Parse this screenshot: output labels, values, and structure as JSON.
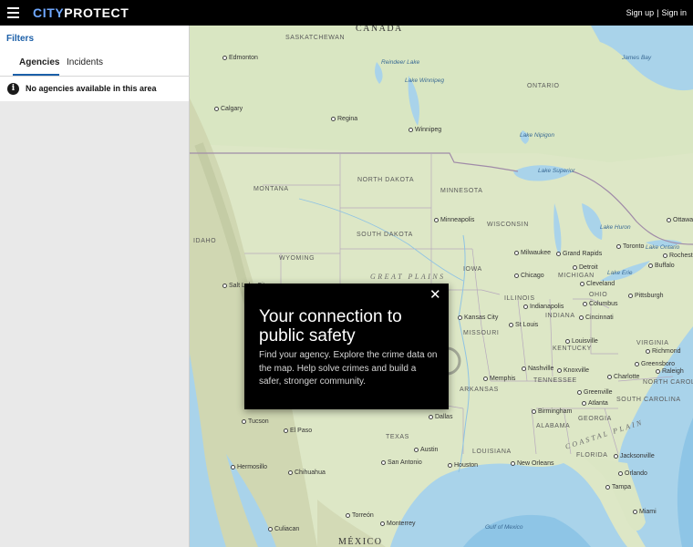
{
  "header": {
    "logo_part1": "CITY",
    "logo_part2": "PROTECT",
    "signup_label": "Sign up",
    "separator": "|",
    "signin_label": "Sign in"
  },
  "sidebar": {
    "filters_label": "Filters",
    "tabs": [
      {
        "label": "Agencies",
        "active": true
      },
      {
        "label": "Incidents",
        "active": false
      }
    ],
    "notice_icon": "info-icon",
    "notice_text": "No agencies available in this area"
  },
  "modal": {
    "title": "Your connection to public safety",
    "body": "Find your agency. Explore the crime data on the map. Help solve crimes and build a safer, stronger community.",
    "close_icon": "close-icon"
  },
  "map": {
    "countries": [
      "CANADA",
      "MÉXICO"
    ],
    "regions": [
      "GREAT PLAINS",
      "COASTAL PLAIN"
    ],
    "states": [
      "SASKATCHEWAN",
      "ONTARIO",
      "MONTANA",
      "NORTH DAKOTA",
      "MINNESOTA",
      "WISCONSIN",
      "SOUTH DAKOTA",
      "IDAHO",
      "WYOMING",
      "IOWA",
      "ILLINOIS",
      "MICHIGAN",
      "INDIANA",
      "OHIO",
      "MISSOURI",
      "KENTUCKY",
      "VIRGINIA",
      "TENNESSEE",
      "NORTH CAROLINA",
      "SOUTH CAROLINA",
      "ARKANSAS",
      "GEORGIA",
      "ALABAMA",
      "TEXAS",
      "LOUISIANA",
      "FLORIDA"
    ],
    "cities": [
      "Edmonton",
      "Calgary",
      "Regina",
      "Winnipeg",
      "Minneapolis",
      "Milwaukee",
      "Grand Rapids",
      "Toronto",
      "Ottawa",
      "Rochester",
      "Buffalo",
      "Detroit",
      "Cleveland",
      "Pittsburgh",
      "Chicago",
      "Columbus",
      "Indianapolis",
      "Cincinnati",
      "Kansas City",
      "St Louis",
      "Louisville",
      "Richmond",
      "Nashville",
      "Knoxville",
      "Greensboro",
      "Raleigh",
      "Charlotte",
      "Memphis",
      "Greenville",
      "Atlanta",
      "Birmingham",
      "Dallas",
      "Tucson",
      "El Paso",
      "Austin",
      "San Antonio",
      "Houston",
      "New Orleans",
      "Jacksonville",
      "Orlando",
      "Tampa",
      "Miami",
      "Hermosillo",
      "Chihuahua",
      "Torreón",
      "Monterrey",
      "Culiacan",
      "Salt Lake City"
    ],
    "water": [
      "Lake Winnipeg",
      "Reindeer Lake",
      "James Bay",
      "Lake Nipigon",
      "Lake Superior",
      "Lake Huron",
      "Lake Erie",
      "Lake Ontario",
      "Gulf of Mexico"
    ],
    "colors": {
      "land": "#dfe8c8",
      "water": "#a9d3ea",
      "deep_water": "#7fbfe2",
      "mountains": "#c7cfa9",
      "border": "#a08ba8"
    }
  }
}
